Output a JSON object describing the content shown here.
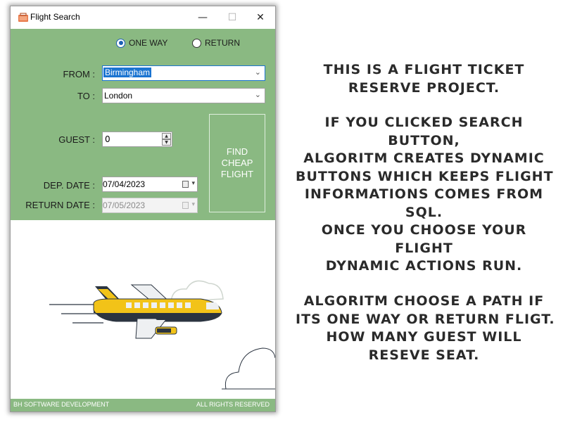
{
  "window": {
    "title": "Flight Search",
    "minimize": "—",
    "maximize": "☐",
    "close": "✕"
  },
  "trip_type": {
    "one_way_label": "ONE WAY",
    "return_label": "RETURN",
    "selected": "ONE WAY"
  },
  "form": {
    "from_label": "FROM :",
    "from_value": "Birmingham",
    "to_label": "TO :",
    "to_value": "London",
    "guest_label": "GUEST :",
    "guest_value": "0",
    "dep_label": "DEP. DATE :",
    "dep_value": "07/04/2023",
    "return_label": "RETURN DATE :",
    "return_value": "07/05/2023"
  },
  "find_button": {
    "line1": "FIND",
    "line2": "CHEAP",
    "line3": "FLIGHT"
  },
  "statusbar": {
    "left": "BH SOFTWARE DEVELOPMENT",
    "right": "ALL RIGHTS RESERVED"
  },
  "description": {
    "block1": [
      "THIS IS A FLIGHT TICKET",
      "RESERVE PROJECT."
    ],
    "block2": [
      "IF YOU CLICKED SEARCH",
      "BUTTON,",
      "ALGORITM CREATES DYNAMIC",
      "BUTTONS WHICH KEEPS FLIGHT",
      "INFORMATIONS COMES FROM",
      "SQL.",
      "ONCE YOU CHOOSE YOUR",
      "FLIGHT",
      "DYNAMIC ACTIONS RUN."
    ],
    "block3": [
      "ALGORITM CHOOSE A PATH IF",
      "ITS ONE WAY OR RETURN FLIGT.",
      "HOW MANY GUEST WILL",
      "RESEVE SEAT."
    ]
  },
  "colors": {
    "panel_green": "#8ab982",
    "plane_yellow": "#f2c318",
    "plane_navy": "#2b3440"
  },
  "icons": [
    "app-icon",
    "chevron-down-icon",
    "calendar-icon",
    "spin-up-icon",
    "spin-down-icon"
  ]
}
